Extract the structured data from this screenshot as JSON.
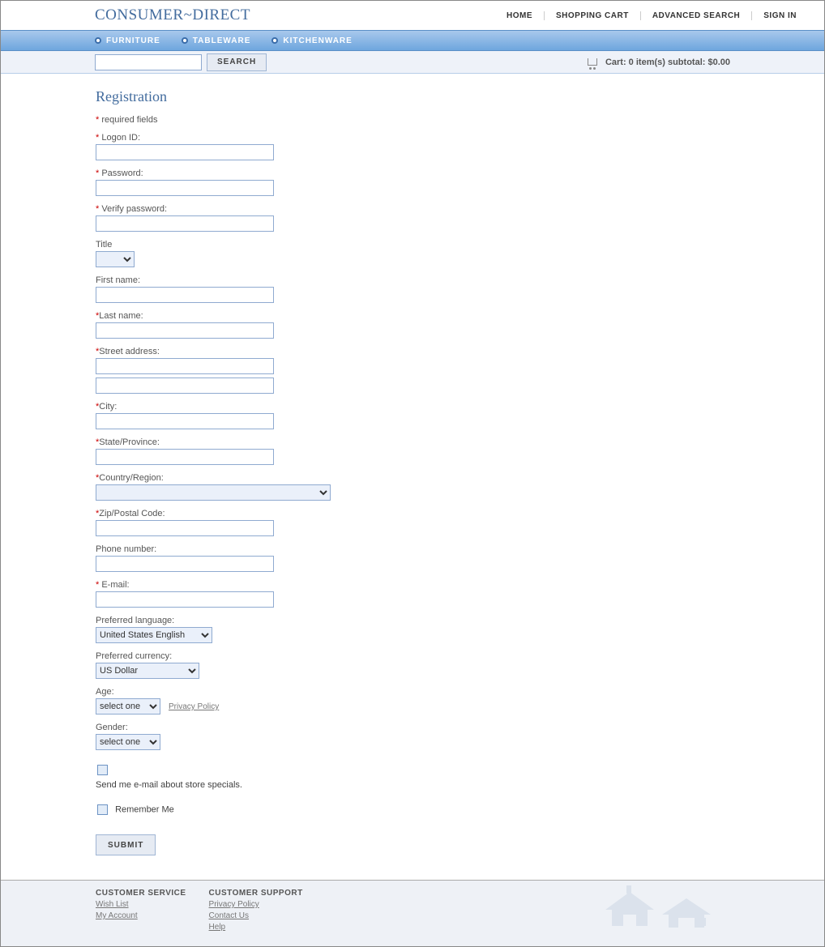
{
  "header": {
    "logo": "CONSUMER~DIRECT",
    "links": [
      "HOME",
      "SHOPPING CART",
      "ADVANCED SEARCH",
      "SIGN IN"
    ]
  },
  "nav": [
    "FURNITURE",
    "TABLEWARE",
    "KITCHENWARE"
  ],
  "search": {
    "button": "SEARCH"
  },
  "cart": {
    "text": "Cart: 0 item(s) subtotal: $0.00"
  },
  "page": {
    "title": "Registration",
    "required_note": "required fields",
    "fields": {
      "logon": "Logon ID:",
      "password": "Password:",
      "verify": "Verify password:",
      "title": "Title",
      "first": "First name:",
      "last": "Last name:",
      "street": "Street address:",
      "city": "City:",
      "state": "State/Province:",
      "country": "Country/Region:",
      "zip": "Zip/Postal Code:",
      "phone": "Phone number:",
      "email": "E-mail:",
      "lang": "Preferred language:",
      "lang_value": "United States English",
      "currency": "Preferred currency:",
      "currency_value": "US Dollar",
      "age": "Age:",
      "age_value": "select one",
      "privacy": "Privacy Policy",
      "gender": "Gender:",
      "gender_value": "select one",
      "specials": "Send me e-mail about store specials.",
      "remember": "Remember Me",
      "submit": "SUBMIT"
    }
  },
  "footer": {
    "service_h": "CUSTOMER SERVICE",
    "service": [
      "Wish List",
      "My Account"
    ],
    "support_h": "CUSTOMER SUPPORT",
    "support": [
      "Privacy Policy",
      "Contact Us",
      "Help"
    ]
  }
}
